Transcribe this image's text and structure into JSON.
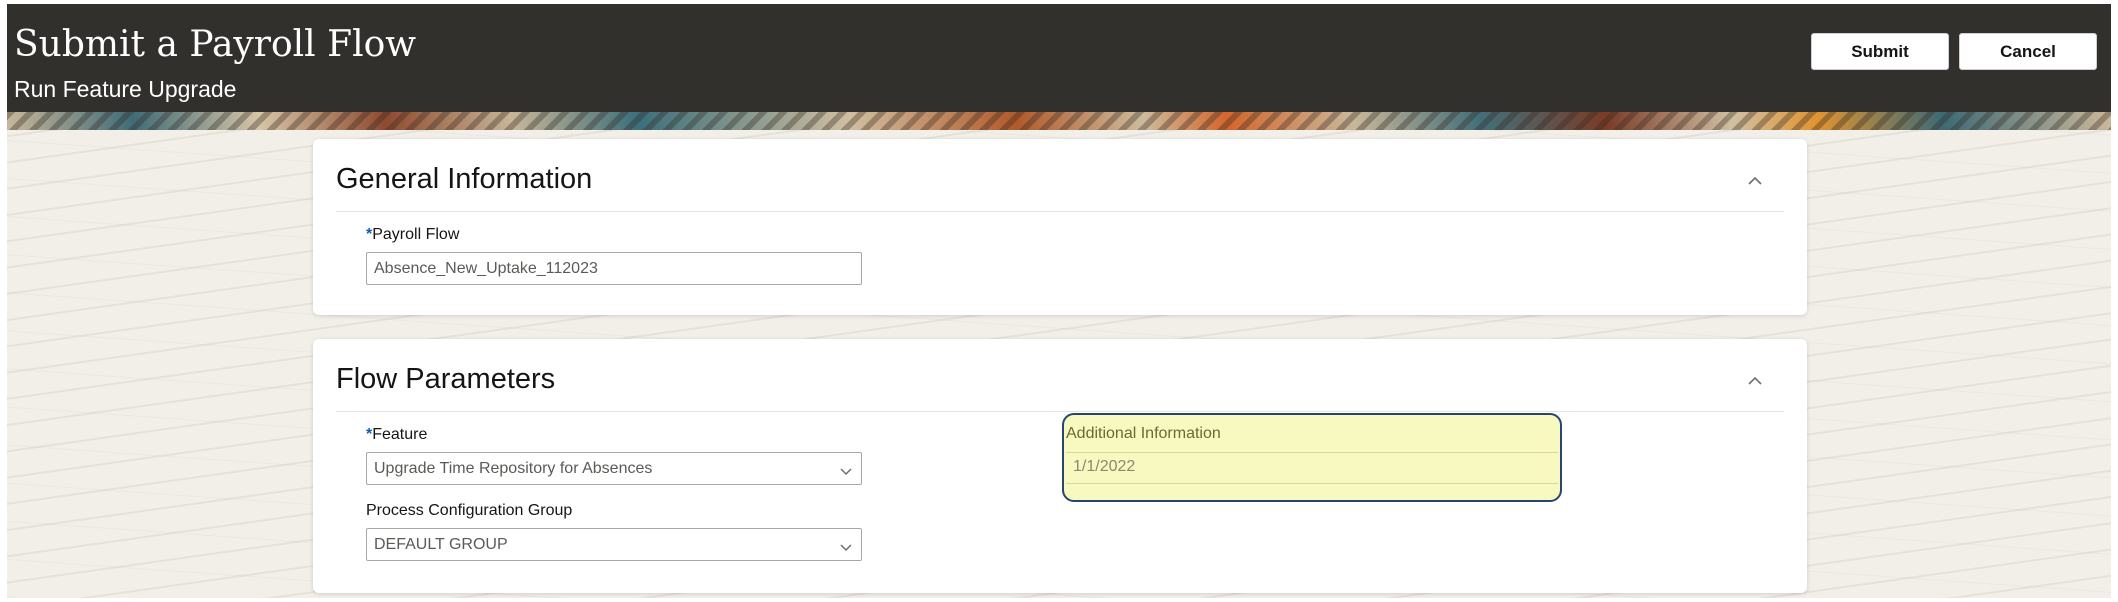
{
  "header": {
    "title": "Submit a Payroll Flow",
    "subtitle": "Run Feature Upgrade",
    "submit_label": "Submit",
    "cancel_label": "Cancel"
  },
  "general_information": {
    "title": "General Information",
    "collapse_icon": "chevron-up-icon",
    "payroll_flow": {
      "required_marker": "*",
      "label": "Payroll Flow",
      "value": "Absence_New_Uptake_112023"
    }
  },
  "flow_parameters": {
    "title": "Flow Parameters",
    "collapse_icon": "chevron-up-icon",
    "feature": {
      "required_marker": "*",
      "label": "Feature",
      "value": "Upgrade Time Repository for Absences"
    },
    "process_configuration_group": {
      "label": "Process Configuration Group",
      "value": "DEFAULT GROUP"
    },
    "additional_information": {
      "label": "Additional Information",
      "value": "1/1/2022"
    }
  },
  "colors": {
    "header_bg": "#31302d",
    "required_marker": "#0d5eaf",
    "highlight_bg": "#f8f9c0",
    "highlight_border": "#26466c"
  }
}
